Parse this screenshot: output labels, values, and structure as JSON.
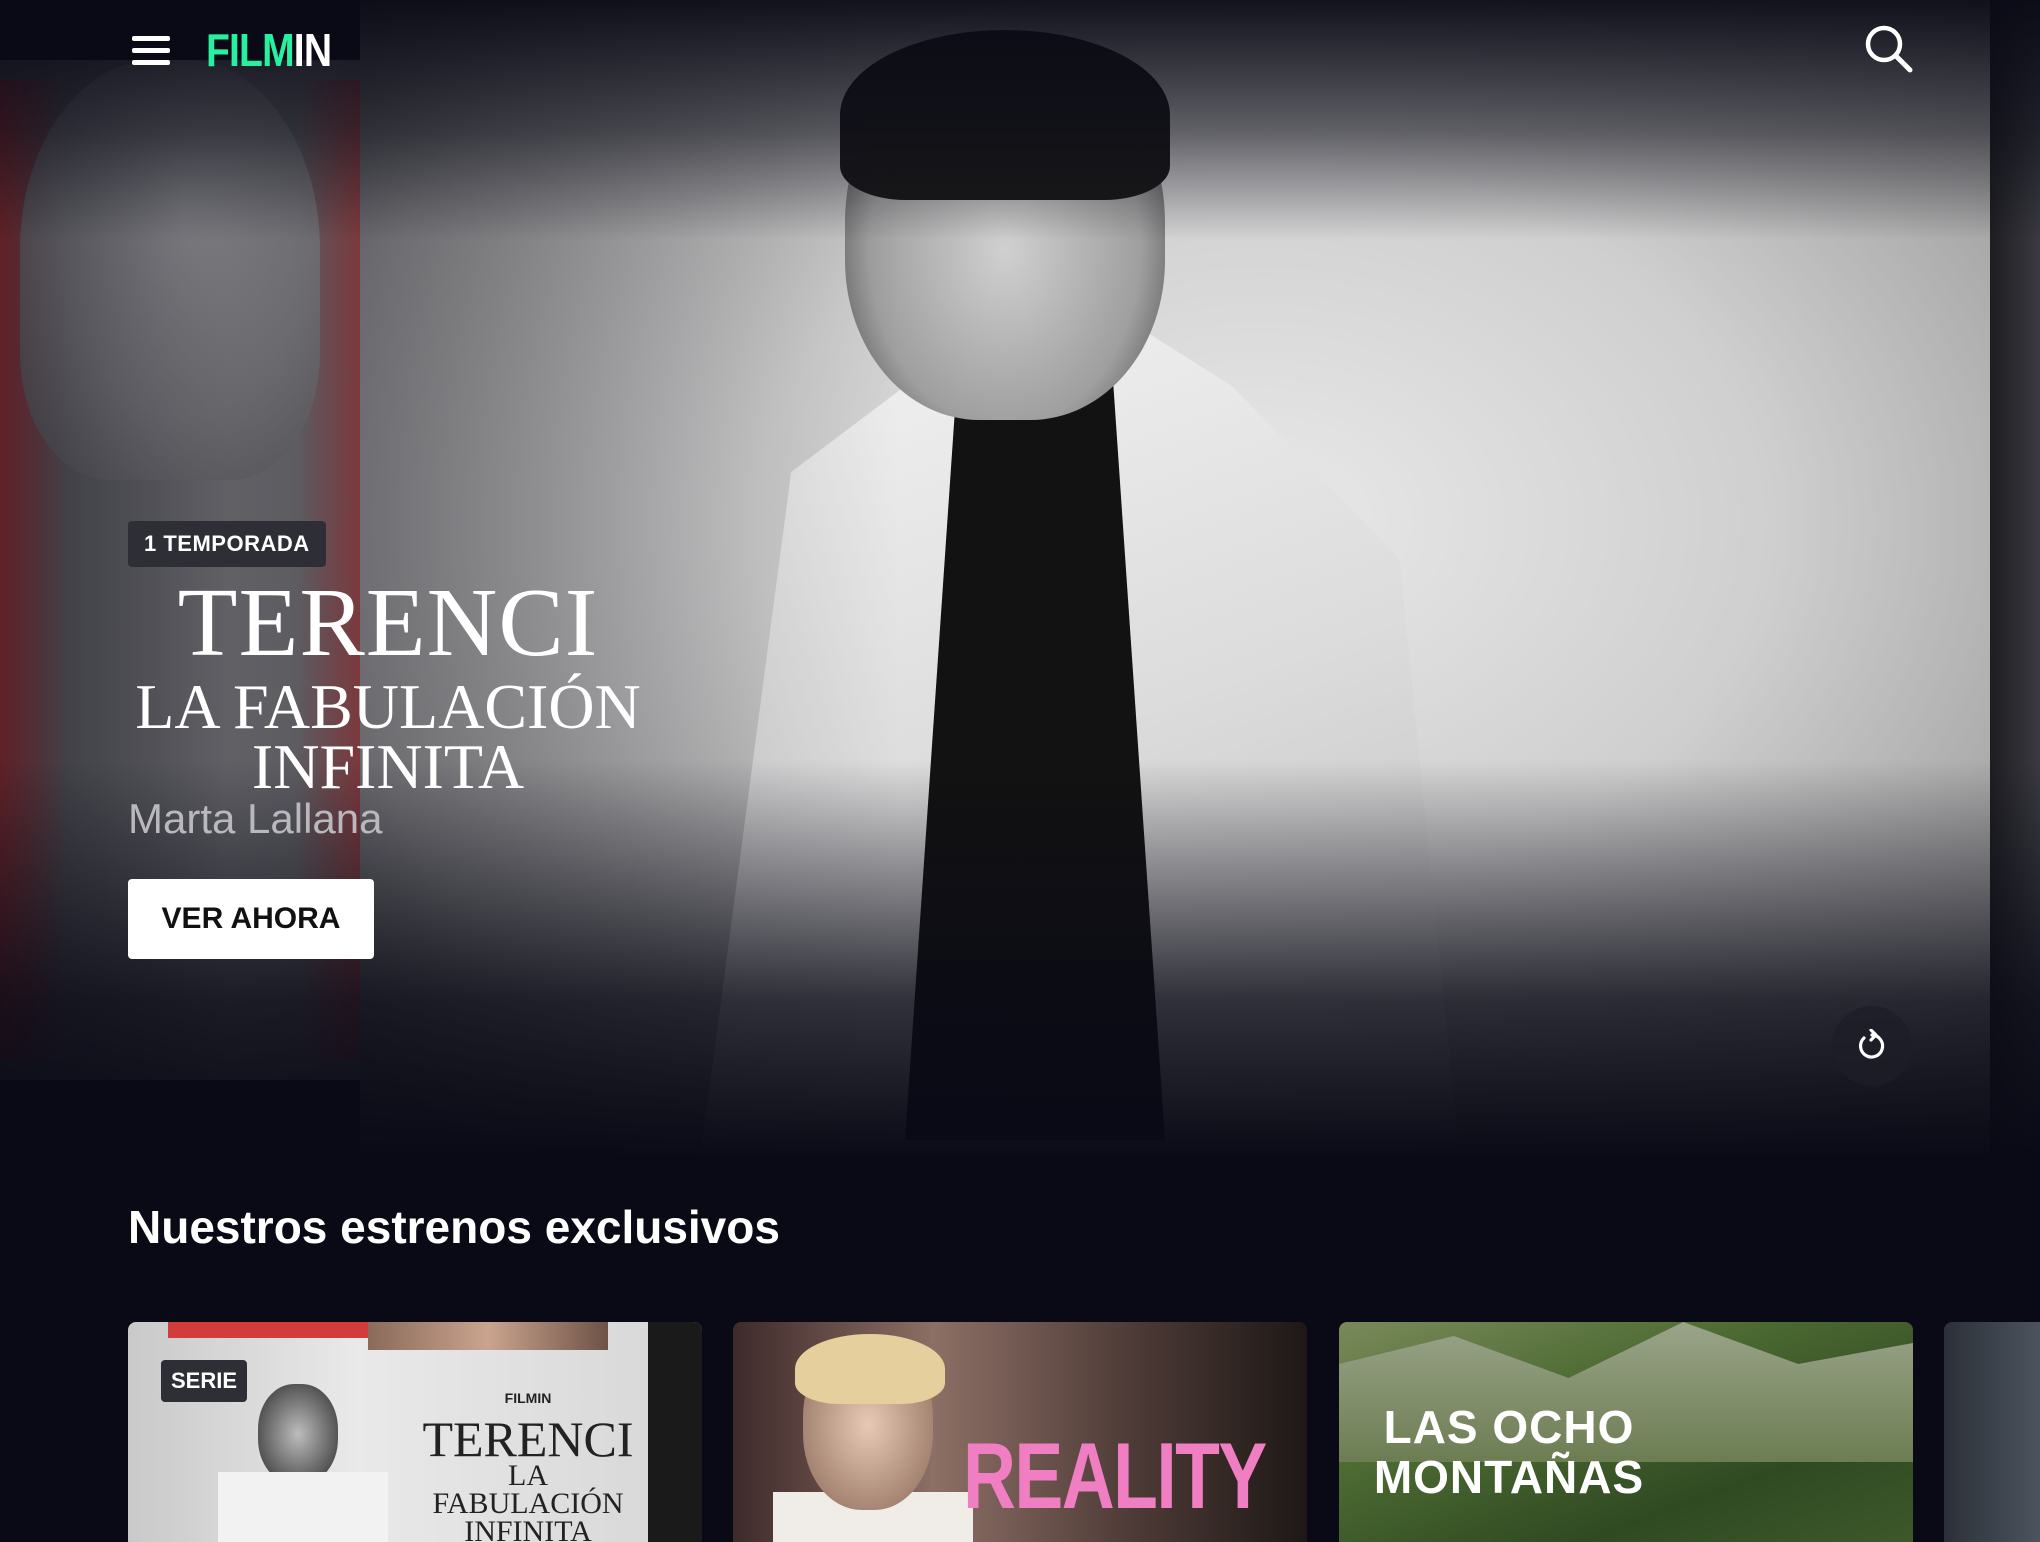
{
  "header": {
    "logo_film": "FILM",
    "logo_in": "IN",
    "menu_icon": "hamburger-menu-icon",
    "search_icon": "search-icon"
  },
  "hero": {
    "badge": "1 TEMPORADA",
    "title_line1": "TERENCI",
    "title_line2": "LA FABULACIÓN",
    "title_line3": "INFINITA",
    "director": "Marta Lallana",
    "cta_label": "VER AHORA",
    "replay_icon": "replay-icon"
  },
  "section": {
    "title": "Nuestros estrenos exclusivos",
    "cards": [
      {
        "badge": "SERIE",
        "brand": "FILMIN",
        "title_line1": "TERENCI",
        "title_line2": "LA",
        "title_line3": "FABULACIÓN",
        "title_line4": "INFINITA"
      },
      {
        "title": "REALITY"
      },
      {
        "title_line1": "LAS OCHO",
        "title_line2": "MONTAÑAS"
      },
      {}
    ]
  },
  "colors": {
    "brand_accent": "#27f0a0",
    "background": "#0a0a16",
    "reality_pink": "#f07ec2"
  }
}
